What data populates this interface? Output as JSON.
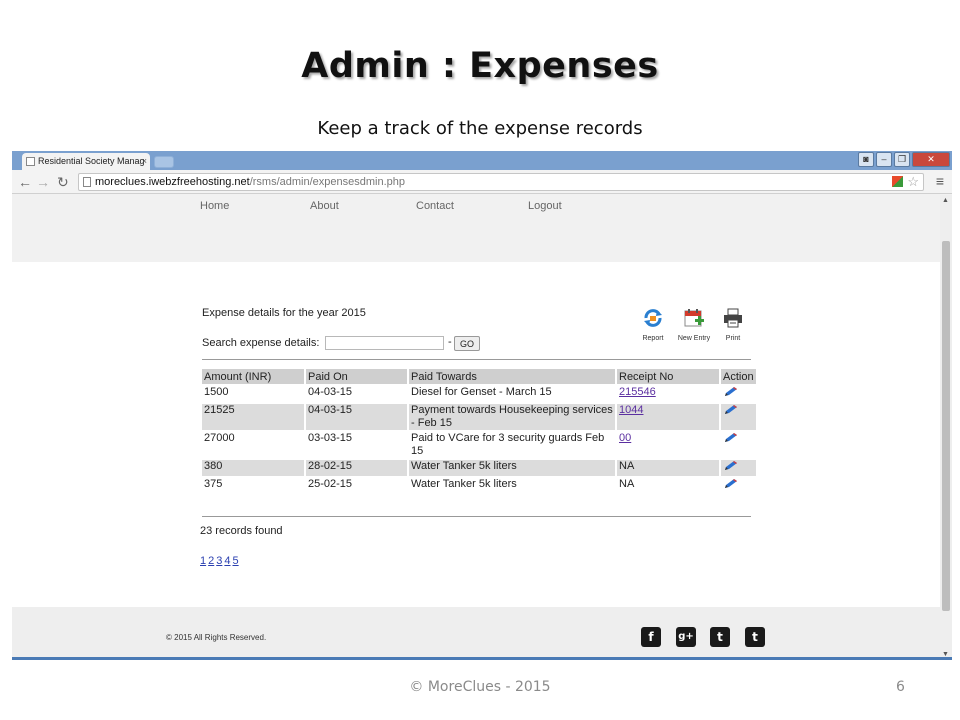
{
  "slide": {
    "title": "Admin : Expenses",
    "subtitle": "Keep a track of the expense records",
    "footer": "© MoreClues - 2015",
    "page_number": "6"
  },
  "browser": {
    "tab_title": "Residential Society Manag",
    "url_host": "moreclues.iwebzfreehosting.net",
    "url_path": "/rsms/admin/expensesdmin.php"
  },
  "site": {
    "nav": [
      "Home",
      "About",
      "Contact",
      "Logout"
    ],
    "content_title": "Expense details for the year 2015",
    "search_label": "Search expense details:",
    "search_value": "",
    "dash": "-",
    "go_label": "GO",
    "actions": [
      {
        "label": "Report",
        "icon": "report-icon"
      },
      {
        "label": "New Entry",
        "icon": "new-entry-icon"
      },
      {
        "label": "Print",
        "icon": "print-icon"
      }
    ],
    "table": {
      "headers": [
        "Amount (INR)",
        "Paid On",
        "Paid Towards",
        "Receipt No",
        "Action"
      ],
      "rows": [
        {
          "amount": "1500",
          "paid_on": "04-03-15",
          "paid_towards": "Diesel for Genset - March 15",
          "receipt": "215546",
          "receipt_link": true
        },
        {
          "amount": "21525",
          "paid_on": "04-03-15",
          "paid_towards": "Payment towards Housekeeping services - Feb 15",
          "receipt": "1044",
          "receipt_link": true
        },
        {
          "amount": "27000",
          "paid_on": "03-03-15",
          "paid_towards": "Paid to VCare for 3 security guards Feb 15",
          "receipt": "00",
          "receipt_link": true
        },
        {
          "amount": "380",
          "paid_on": "28-02-15",
          "paid_towards": "Water Tanker 5k liters",
          "receipt": "NA",
          "receipt_link": false
        },
        {
          "amount": "375",
          "paid_on": "25-02-15",
          "paid_towards": "Water Tanker 5k liters",
          "receipt": "NA",
          "receipt_link": false
        }
      ]
    },
    "records_found": "23 records found",
    "pages": [
      "1",
      "2",
      "3",
      "4",
      "5"
    ],
    "copyright": "© 2015 All Rights Reserved.",
    "social": [
      {
        "icon": "facebook-icon",
        "glyph": "f"
      },
      {
        "icon": "google-plus-icon",
        "glyph": "g+"
      },
      {
        "icon": "twitter-icon",
        "glyph": "t"
      },
      {
        "icon": "tumblr-icon",
        "glyph": "t"
      }
    ]
  }
}
